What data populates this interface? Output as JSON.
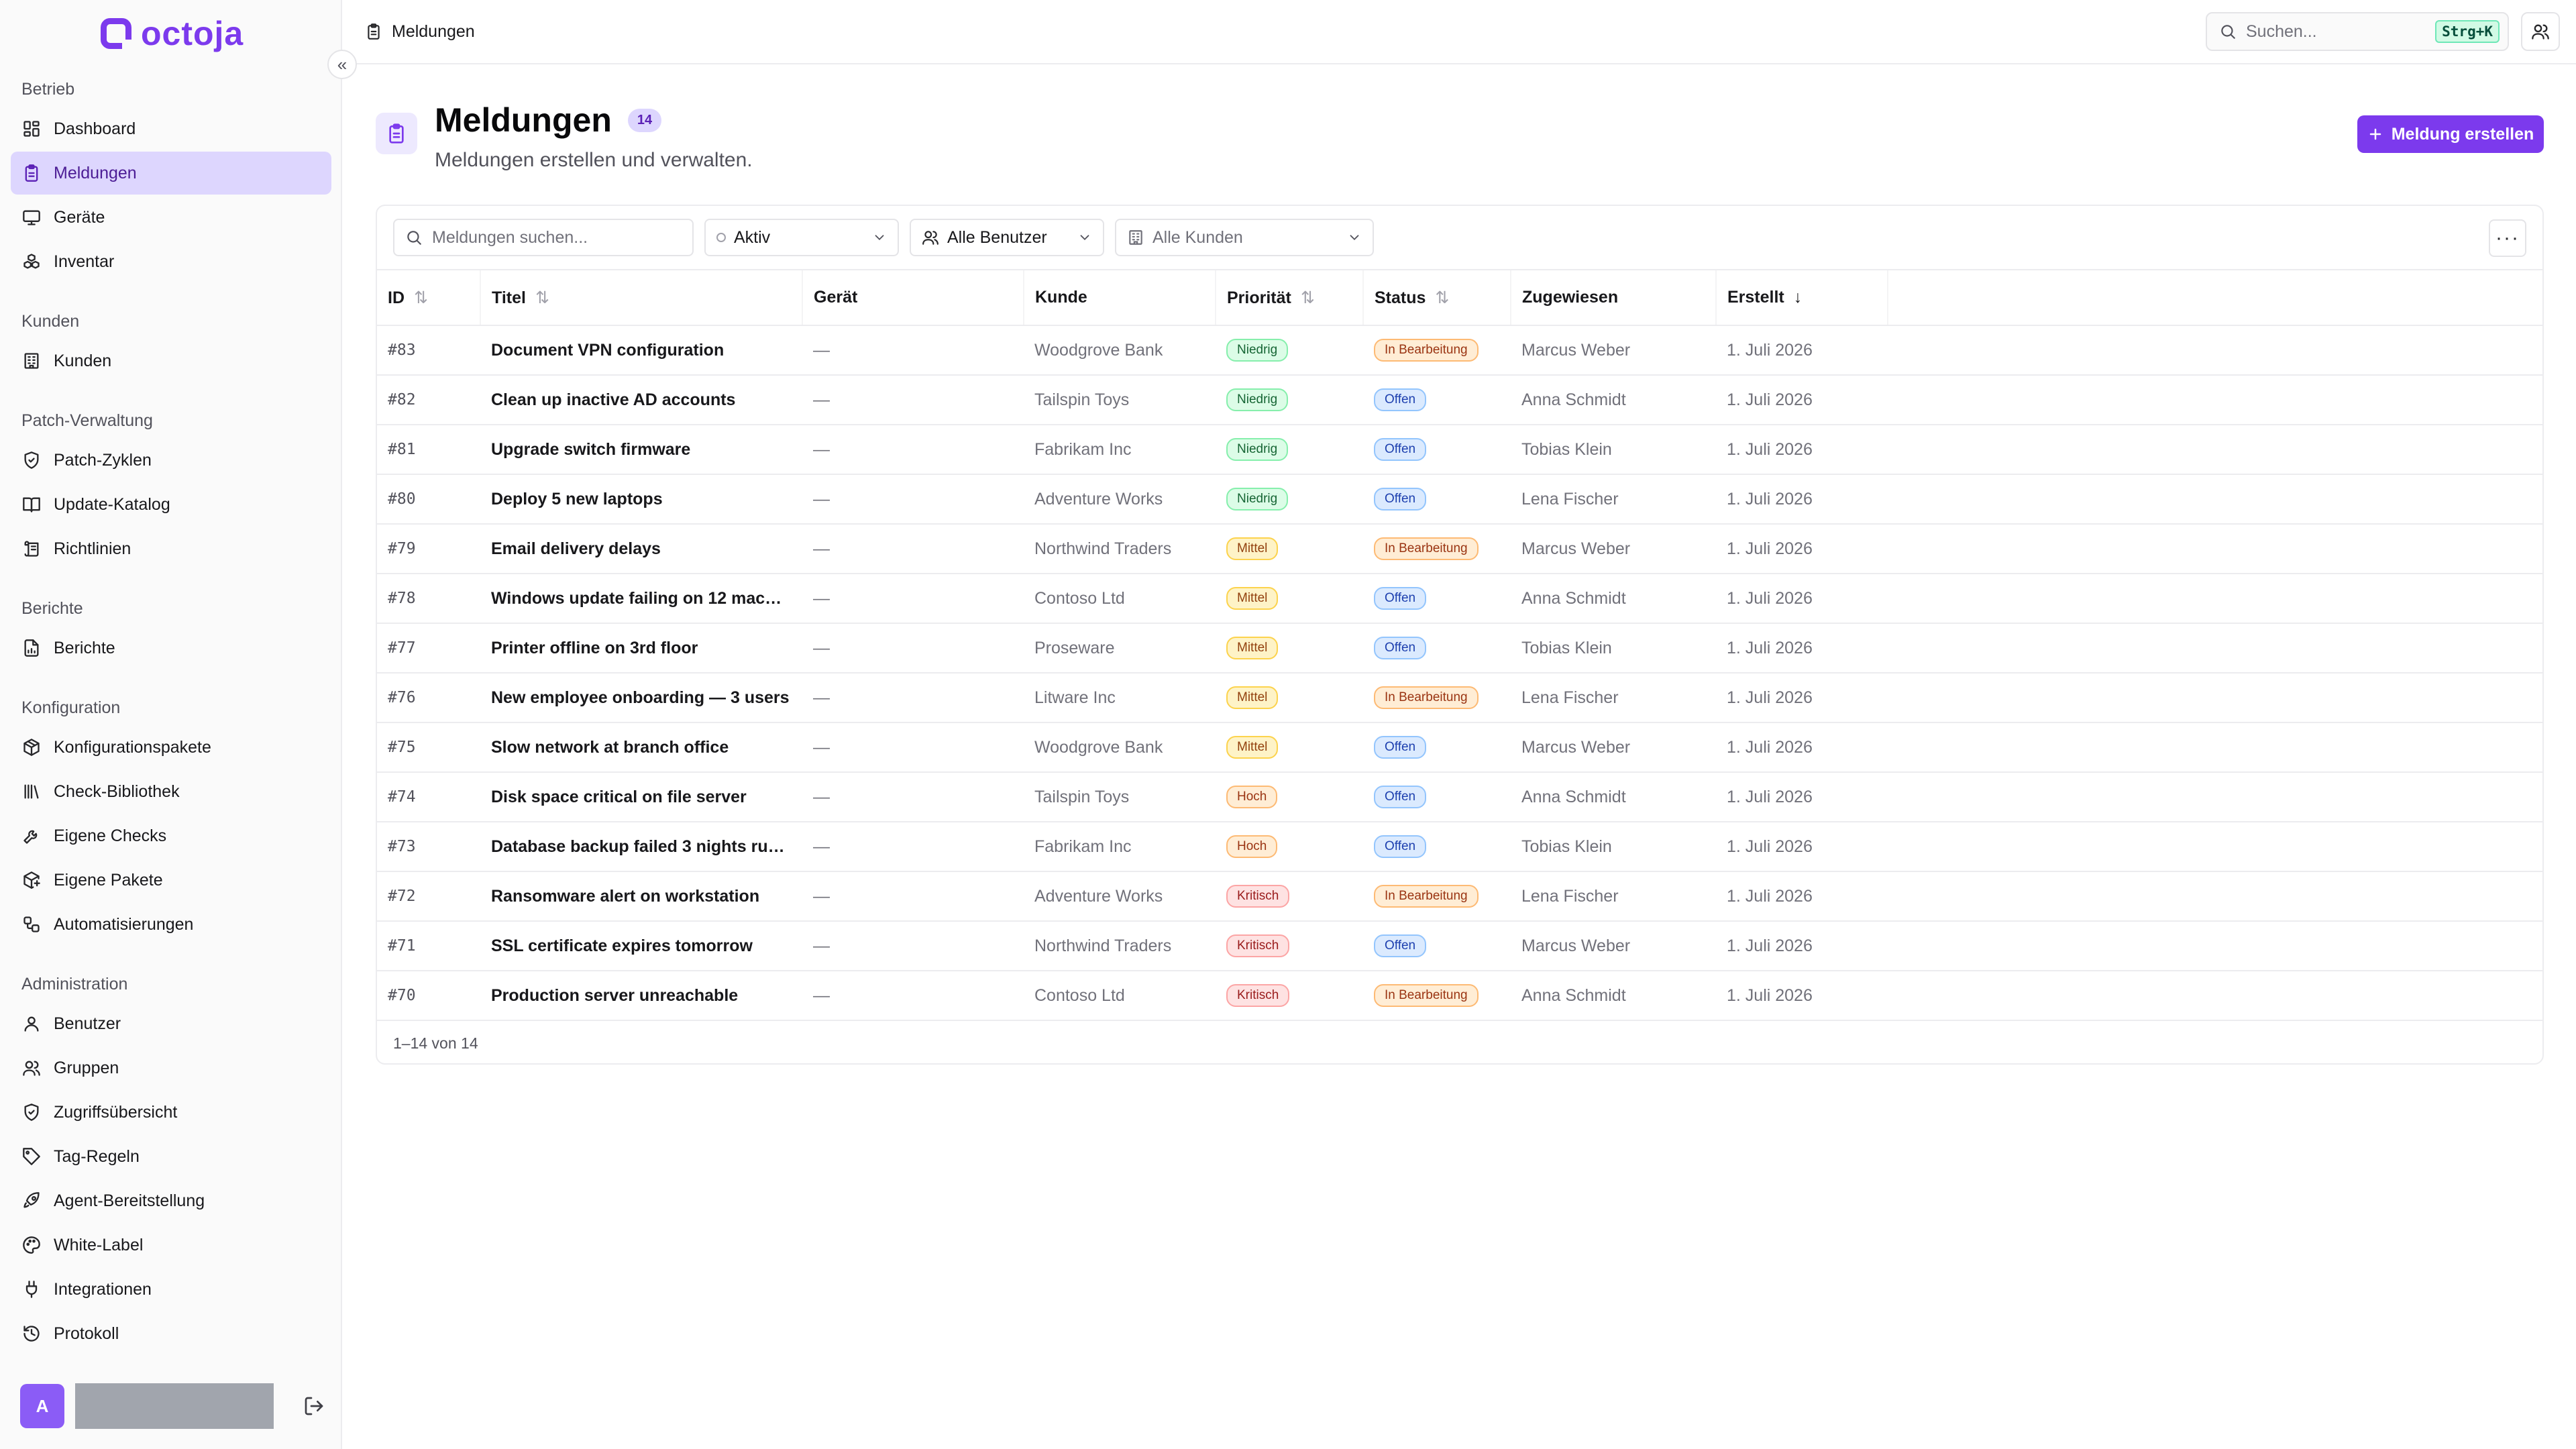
{
  "brand": {
    "name": "octoja",
    "color": "#7c3aed"
  },
  "sidebar": {
    "sections": [
      {
        "label": "Betrieb",
        "items": [
          {
            "label": "Dashboard",
            "icon": "dashboard-icon"
          },
          {
            "label": "Meldungen",
            "icon": "clipboard-icon",
            "active": true
          },
          {
            "label": "Geräte",
            "icon": "monitor-icon"
          },
          {
            "label": "Inventar",
            "icon": "boxes-icon"
          }
        ]
      },
      {
        "label": "Kunden",
        "items": [
          {
            "label": "Kunden",
            "icon": "building-icon"
          }
        ]
      },
      {
        "label": "Patch-Verwaltung",
        "items": [
          {
            "label": "Patch-Zyklen",
            "icon": "shield-check-icon"
          },
          {
            "label": "Update-Katalog",
            "icon": "book-icon"
          },
          {
            "label": "Richtlinien",
            "icon": "scroll-icon"
          }
        ]
      },
      {
        "label": "Berichte",
        "items": [
          {
            "label": "Berichte",
            "icon": "report-icon"
          }
        ]
      },
      {
        "label": "Konfiguration",
        "items": [
          {
            "label": "Konfigurationspakete",
            "icon": "package-icon"
          },
          {
            "label": "Check-Bibliothek",
            "icon": "library-icon"
          },
          {
            "label": "Eigene Checks",
            "icon": "wrench-icon"
          },
          {
            "label": "Eigene Pakete",
            "icon": "package-plus-icon"
          },
          {
            "label": "Automatisierungen",
            "icon": "workflow-icon"
          }
        ]
      },
      {
        "label": "Administration",
        "items": [
          {
            "label": "Benutzer",
            "icon": "user-icon"
          },
          {
            "label": "Gruppen",
            "icon": "users-icon"
          },
          {
            "label": "Zugriffsübersicht",
            "icon": "shield-icon"
          },
          {
            "label": "Tag-Regeln",
            "icon": "tag-icon"
          },
          {
            "label": "Agent-Bereitstellung",
            "icon": "rocket-icon"
          },
          {
            "label": "White-Label",
            "icon": "palette-icon"
          },
          {
            "label": "Integrationen",
            "icon": "plug-icon"
          },
          {
            "label": "Protokoll",
            "icon": "history-icon"
          }
        ]
      }
    ],
    "avatar_initial": "A"
  },
  "topbar": {
    "breadcrumb": "Meldungen",
    "search_placeholder": "Suchen...",
    "shortcut": "Strg+K"
  },
  "page": {
    "title": "Meldungen",
    "count": "14",
    "subtitle": "Meldungen erstellen und verwalten.",
    "create_label": "Meldung erstellen"
  },
  "filters": {
    "search_placeholder": "Meldungen suchen...",
    "status": "Aktiv",
    "users": "Alle Benutzer",
    "customers": "Alle Kunden"
  },
  "table": {
    "columns": [
      "ID",
      "Titel",
      "Gerät",
      "Kunde",
      "Priorität",
      "Status",
      "Zugewiesen",
      "Erstellt"
    ],
    "rows": [
      {
        "id": "#83",
        "title": "Document VPN configuration",
        "device": "—",
        "customer": "Woodgrove Bank",
        "priority": "Niedrig",
        "status": "In Bearbeitung",
        "assignee": "Marcus Weber",
        "created": "1. Juli 2026"
      },
      {
        "id": "#82",
        "title": "Clean up inactive AD accounts",
        "device": "—",
        "customer": "Tailspin Toys",
        "priority": "Niedrig",
        "status": "Offen",
        "assignee": "Anna Schmidt",
        "created": "1. Juli 2026"
      },
      {
        "id": "#81",
        "title": "Upgrade switch firmware",
        "device": "—",
        "customer": "Fabrikam Inc",
        "priority": "Niedrig",
        "status": "Offen",
        "assignee": "Tobias Klein",
        "created": "1. Juli 2026"
      },
      {
        "id": "#80",
        "title": "Deploy 5 new laptops",
        "device": "—",
        "customer": "Adventure Works",
        "priority": "Niedrig",
        "status": "Offen",
        "assignee": "Lena Fischer",
        "created": "1. Juli 2026"
      },
      {
        "id": "#79",
        "title": "Email delivery delays",
        "device": "—",
        "customer": "Northwind Traders",
        "priority": "Mittel",
        "status": "In Bearbeitung",
        "assignee": "Marcus Weber",
        "created": "1. Juli 2026"
      },
      {
        "id": "#78",
        "title": "Windows update failing on 12 machin...",
        "device": "—",
        "customer": "Contoso Ltd",
        "priority": "Mittel",
        "status": "Offen",
        "assignee": "Anna Schmidt",
        "created": "1. Juli 2026"
      },
      {
        "id": "#77",
        "title": "Printer offline on 3rd floor",
        "device": "—",
        "customer": "Proseware",
        "priority": "Mittel",
        "status": "Offen",
        "assignee": "Tobias Klein",
        "created": "1. Juli 2026"
      },
      {
        "id": "#76",
        "title": "New employee onboarding — 3 users",
        "device": "—",
        "customer": "Litware Inc",
        "priority": "Mittel",
        "status": "In Bearbeitung",
        "assignee": "Lena Fischer",
        "created": "1. Juli 2026"
      },
      {
        "id": "#75",
        "title": "Slow network at branch office",
        "device": "—",
        "customer": "Woodgrove Bank",
        "priority": "Mittel",
        "status": "Offen",
        "assignee": "Marcus Weber",
        "created": "1. Juli 2026"
      },
      {
        "id": "#74",
        "title": "Disk space critical on file server",
        "device": "—",
        "customer": "Tailspin Toys",
        "priority": "Hoch",
        "status": "Offen",
        "assignee": "Anna Schmidt",
        "created": "1. Juli 2026"
      },
      {
        "id": "#73",
        "title": "Database backup failed 3 nights run...",
        "device": "—",
        "customer": "Fabrikam Inc",
        "priority": "Hoch",
        "status": "Offen",
        "assignee": "Tobias Klein",
        "created": "1. Juli 2026"
      },
      {
        "id": "#72",
        "title": "Ransomware alert on workstation",
        "device": "—",
        "customer": "Adventure Works",
        "priority": "Kritisch",
        "status": "In Bearbeitung",
        "assignee": "Lena Fischer",
        "created": "1. Juli 2026"
      },
      {
        "id": "#71",
        "title": "SSL certificate expires tomorrow",
        "device": "—",
        "customer": "Northwind Traders",
        "priority": "Kritisch",
        "status": "Offen",
        "assignee": "Marcus Weber",
        "created": "1. Juli 2026"
      },
      {
        "id": "#70",
        "title": "Production server unreachable",
        "device": "—",
        "customer": "Contoso Ltd",
        "priority": "Kritisch",
        "status": "In Bearbeitung",
        "assignee": "Anna Schmidt",
        "created": "1. Juli 2026"
      }
    ],
    "footer": "1–14 von 14"
  }
}
